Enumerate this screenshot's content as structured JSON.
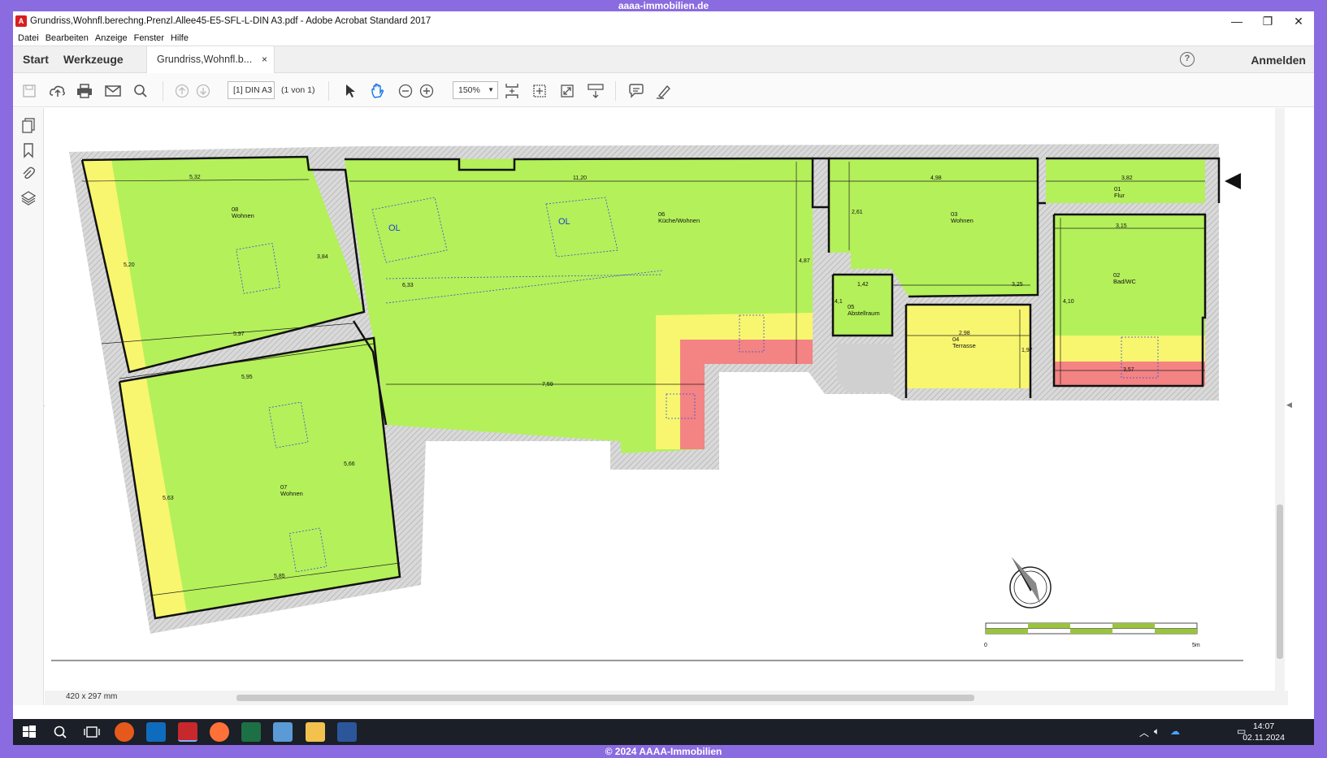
{
  "banner_top": "aaaa-immobilien.de",
  "banner_bottom": "© 2024 AAAA-Immobilien",
  "window": {
    "title": "Grundriss,Wohnfl.berechng.Prenzl.Allee45-E5-SFL-L-DIN A3.pdf - Adobe Acrobat Standard 2017",
    "minimize": "—",
    "maximize": "❐",
    "close": "✕"
  },
  "menu": [
    "Datei",
    "Bearbeiten",
    "Anzeige",
    "Fenster",
    "Hilfe"
  ],
  "tabs": {
    "start": "Start",
    "tools": "Werkzeuge",
    "document": "Grundriss,Wohnfl.b...",
    "close": "×",
    "help": "?",
    "signin": "Anmelden"
  },
  "toolbar": {
    "page_field": "[1] DIN A3",
    "page_of": "(1 von 1)",
    "zoom": "150%"
  },
  "status": {
    "page_size": "420 x 297 mm"
  },
  "plan": {
    "rooms": [
      {
        "num": "08",
        "name": "Wohnen"
      },
      {
        "num": "06",
        "name": "Küche/Wohnen"
      },
      {
        "num": "03",
        "name": "Wohnen"
      },
      {
        "num": "01",
        "name": "Flur"
      },
      {
        "num": "02",
        "name": "Bad/WC"
      },
      {
        "num": "05",
        "name": "Abstellraum"
      },
      {
        "num": "04",
        "name": "Terrasse"
      },
      {
        "num": "07",
        "name": "Wohnen"
      }
    ],
    "skylights": [
      "OL",
      "OL"
    ],
    "dimensions": [
      "5,32",
      "11,20",
      "4,98",
      "3,82",
      "3,15",
      "2,61",
      "4,87",
      "3,84",
      "6,33",
      "5,20",
      "5,97",
      "5,95",
      "7,59",
      "1,42",
      "3,25",
      "4,10",
      "2,98",
      "1,97",
      "3,57",
      "5,63",
      "5,66",
      "5,85",
      "4,1"
    ],
    "scale_start": "0",
    "scale_end": "5m"
  },
  "taskbar": {
    "time": "14:07",
    "date": "02.11.2024"
  }
}
